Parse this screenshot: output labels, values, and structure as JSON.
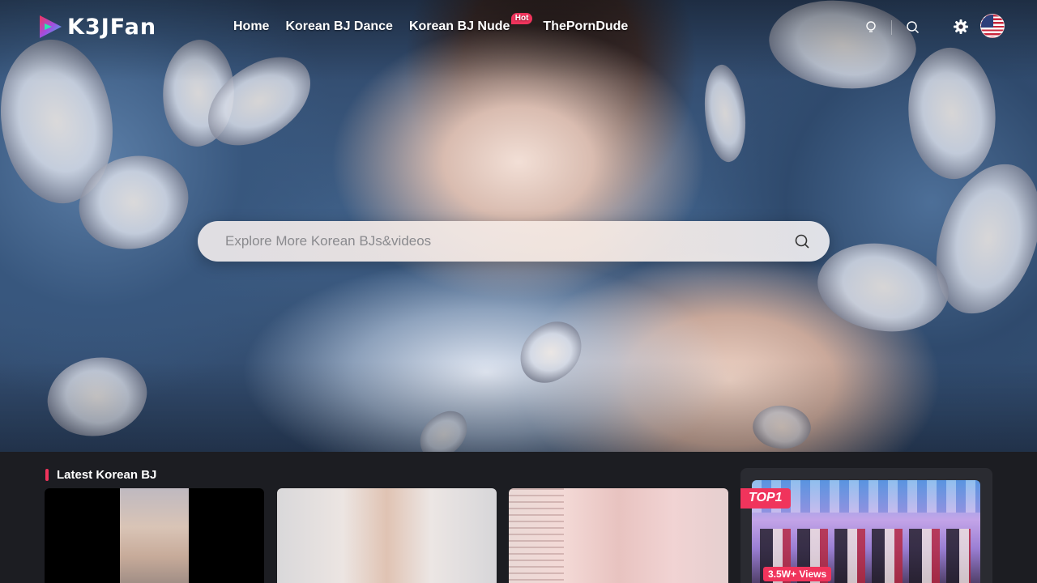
{
  "brand": {
    "logo_text": "K3JFan",
    "accent_color": "#f0345c"
  },
  "nav": {
    "items": [
      {
        "label": "Home"
      },
      {
        "label": "Korean BJ Dance"
      },
      {
        "label": "Korean BJ Nude",
        "badge": "Hot"
      },
      {
        "label": "ThePornDude"
      }
    ]
  },
  "header_icons": [
    "bulb-icon",
    "search-icon",
    "gear-icon",
    "us-flag-icon"
  ],
  "search": {
    "placeholder": "Explore More Korean BJs&videos"
  },
  "section": {
    "title": "Latest Korean BJ"
  },
  "featured": {
    "rank_badge": "TOP1",
    "views": "3.5W+ Views"
  }
}
